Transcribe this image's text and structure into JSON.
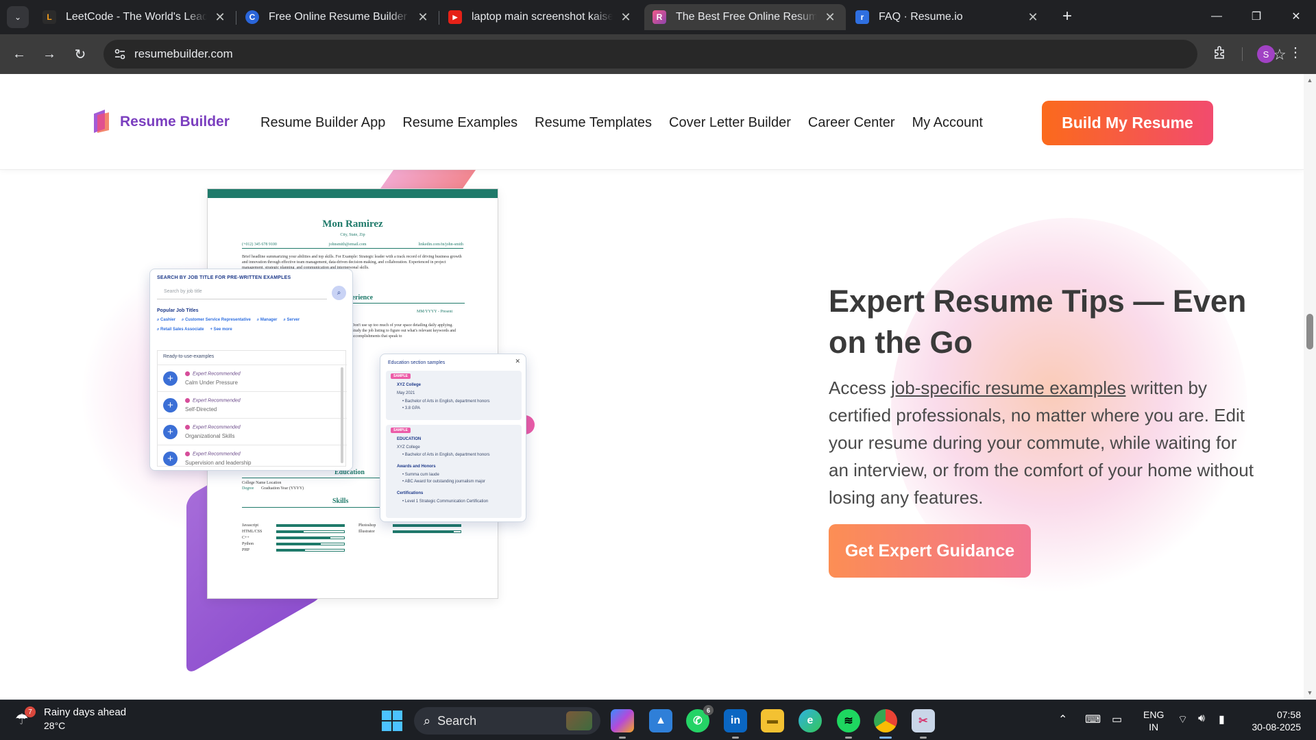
{
  "browser": {
    "tabs": [
      {
        "title": "LeetCode - The World's Leading",
        "favicon_color": "#2b2b2b",
        "favicon_glyph": "L",
        "active": false
      },
      {
        "title": "Free Online Resume Builder | Ea",
        "favicon_color": "#2a65d9",
        "favicon_glyph": "C",
        "active": false
      },
      {
        "title": "laptop main screenshot kaise le",
        "favicon_color": "#e62117",
        "favicon_glyph": "▶",
        "active": false
      },
      {
        "title": "The Best Free Online Resume Bu",
        "favicon_color": "#8e44ad",
        "favicon_glyph": "R",
        "active": true
      },
      {
        "title": "FAQ · Resume.io",
        "favicon_color": "#2f6fe0",
        "favicon_glyph": "r",
        "active": false
      }
    ],
    "url": "resumebuilder.com",
    "profile_initial": "S"
  },
  "site": {
    "logo_text": "Resume Builder",
    "nav": [
      "Resume Builder App",
      "Resume Examples",
      "Resume Templates",
      "Cover Letter Builder",
      "Career Center",
      "My Account"
    ],
    "cta": "Build My Resume"
  },
  "hero": {
    "title": "Expert Resume Tips — Even on the Go",
    "body_prefix": "Access ",
    "body_link": "job-specific resume examples",
    "body_suffix": " written by certified professionals, no matter where you are. Edit your resume during your commute, while waiting for an interview, or from the comfort of your home without losing any features.",
    "button": "Get Expert Guidance"
  },
  "illustration": {
    "resume": {
      "name": "Mon Ramirez",
      "city": "City, State, Zip",
      "phone": "(+012) 345 678 9100",
      "email": "johnsmith@email.com",
      "linkedin": "linkedin.com/in/john-smith",
      "summary": "Brief headline summarizing your abilities and top skills. For Example: Strategic leader with a track record of driving business growth and innovation through effective team management, data-driven decision-making, and collaboration. Experienced in project management, strategic planning, and communication and interpersonal skills.",
      "experience_heading": "perience",
      "experience_dates": "MM/YYYY - Present",
      "experience_frag": "Don't use up too much of your space detailing daily applying. Study the job listing to figure out what's relevant keywords and accomplishments that speak to",
      "education_heading": "Education",
      "education_line1": "College Name    Location",
      "education_degree": "Degree",
      "education_year": "Graduation Year (YYYY)",
      "skills_heading": "Skills",
      "skills_left": [
        {
          "name": "Javascript",
          "level": 1.0
        },
        {
          "name": "HTML/CSS",
          "level": 0.4
        },
        {
          "name": "C++",
          "level": 0.8
        },
        {
          "name": "Python",
          "level": 0.65
        },
        {
          "name": "PHP",
          "level": 0.42
        }
      ],
      "skills_right": [
        {
          "name": "Photoshop",
          "level": 1.0
        },
        {
          "name": "Illustrator",
          "level": 0.9
        }
      ]
    },
    "search_card": {
      "title": "SEARCH BY JOB TITLE FOR PRE-WRITTEN EXAMPLES",
      "placeholder": "Search by job title",
      "popular_title": "Popular Job Titles",
      "chips": [
        "Cashier",
        "Customer Service Representative",
        "Manager",
        "Server",
        "Retail Sales Associate",
        "+ See more"
      ],
      "ready_title": "Ready-to-use-examples",
      "badge": "Expert Recommended",
      "items": [
        "Calm Under Pressure",
        "Self-Directed",
        "Organizational Skills",
        "Supervision and leadership"
      ]
    },
    "edu_card": {
      "title": "Education section samples",
      "sample_badge": "SAMPLE",
      "sample1": {
        "school": "XYZ College",
        "date": "May 2021",
        "bullets": [
          "Bachelor of Arts in English, department honors",
          "3.8 GPA"
        ]
      },
      "sample2": {
        "heading": "EDUCATION",
        "school": "XYZ College",
        "bullet": "Bachelor of Arts in English, department honors",
        "awards_heading": "Awards and Honors",
        "awards": [
          "Summa cum laude",
          "ABC Award for outstanding journalism major"
        ],
        "cert_heading": "Certifications",
        "certs": [
          "Level 1 Strategic Communication Certification"
        ]
      }
    }
  },
  "taskbar": {
    "weather_title": "Rainy days ahead",
    "weather_temp": "28°C",
    "weather_badge": "7",
    "search_label": "Search",
    "whatsapp_badge": "6",
    "lang_line1": "ENG",
    "lang_line2": "IN",
    "time": "07:58",
    "date": "30-08-2025"
  }
}
